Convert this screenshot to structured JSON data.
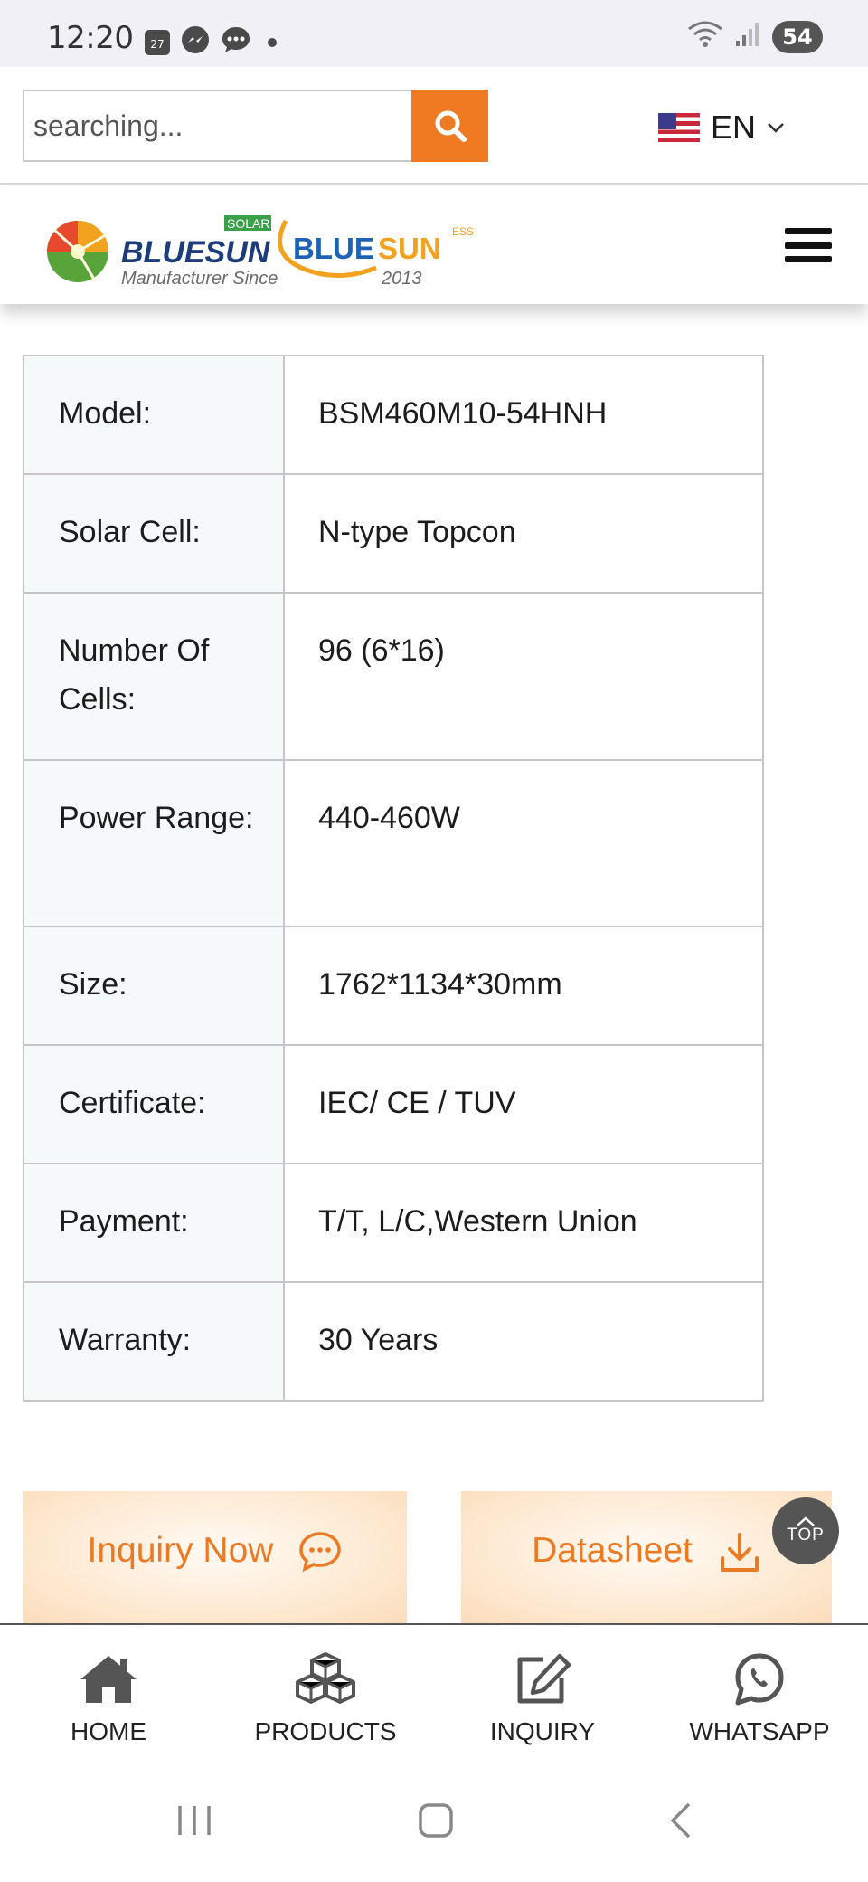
{
  "status_bar": {
    "time": "12:20",
    "calendar_day": "27",
    "battery": "54",
    "icons": [
      "calendar-icon",
      "messenger-icon",
      "chat-icon",
      "dot-icon",
      "wifi-icon",
      "signal-icon"
    ]
  },
  "search": {
    "placeholder": "searching...",
    "button_icon": "search-icon"
  },
  "language": {
    "label": "EN",
    "flag": "us-flag-icon"
  },
  "logo": {
    "brand_main": "BLUESUN",
    "brand_badge": "SOLAR",
    "tagline_1": "Manufacturer Since",
    "brand_secondary_1": "BLUE",
    "brand_secondary_2": "SUN",
    "brand_secondary_badge": "ESS",
    "year": "2013"
  },
  "specs": [
    {
      "label": "Model:",
      "value": "BSM460M10-54HNH"
    },
    {
      "label": "Solar Cell:",
      "value": "N-type Topcon"
    },
    {
      "label": "Number Of Cells:",
      "value": "96 (6*16)"
    },
    {
      "label": "Power Range:",
      "value": "440-460W"
    },
    {
      "label": "Size:",
      "value": "1762*1134*30mm"
    },
    {
      "label": "Certificate:",
      "value": "IEC/ CE / TUV"
    },
    {
      "label": "Payment:",
      "value": "T/T, L/C,Western Union"
    },
    {
      "label": "Warranty:",
      "value": "30 Years"
    }
  ],
  "actions": {
    "inquiry_label": "Inquiry Now",
    "datasheet_label": "Datasheet",
    "top_label": "TOP"
  },
  "bottom_nav": [
    {
      "label": "HOME",
      "icon": "home-icon"
    },
    {
      "label": "PRODUCTS",
      "icon": "cubes-icon"
    },
    {
      "label": "INQUIRY",
      "icon": "edit-icon"
    },
    {
      "label": "WHATSAPP",
      "icon": "whatsapp-icon"
    }
  ],
  "colors": {
    "accent": "#ef7a22",
    "button_bg": "#fde7cd",
    "table_key_bg": "#f6f9f9",
    "status_bar_bg": "#f1f0f6"
  }
}
